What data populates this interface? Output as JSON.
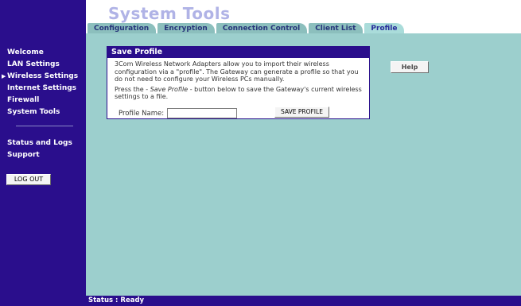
{
  "header": {
    "title": "System Tools"
  },
  "tabs": [
    {
      "label": "Configuration",
      "active": false
    },
    {
      "label": "Encryption",
      "active": false
    },
    {
      "label": "Connection Control",
      "active": false
    },
    {
      "label": "Client List",
      "active": false
    },
    {
      "label": "Profile",
      "active": true
    }
  ],
  "sidebar": {
    "items": [
      {
        "label": "Welcome"
      },
      {
        "label": "LAN Settings"
      },
      {
        "label": "Wireless Settings",
        "current": true
      },
      {
        "label": "Internet Settings"
      },
      {
        "label": "Firewall"
      },
      {
        "label": "System Tools"
      }
    ],
    "items2": [
      {
        "label": "Status and Logs"
      },
      {
        "label": "Support"
      }
    ],
    "logout_label": "LOG OUT",
    "current_arrow": "▶"
  },
  "panel": {
    "title": "Save Profile",
    "para1": "3Com Wireless Network Adapters allow you to import their wireless configuration via a \"profile\". The Gateway can generate a profile so that you do not need to configure your Wireless PCs manually.",
    "para2_prefix": "Press the - ",
    "para2_em": "Save Profile",
    "para2_suffix": " - button below to save the Gateway's current wireless settings to a file.",
    "profile_label": "Profile Name:",
    "profile_value": "",
    "save_label": "SAVE PROFILE"
  },
  "help_label": "Help",
  "status": {
    "text": "Status : Ready"
  },
  "colors": {
    "nav_bg": "#2a0e8c",
    "content_bg": "#9ccfcd",
    "tab_bg": "#8cbfbd",
    "tab_active_bg": "#aadcda",
    "title_color": "#b0b3e6"
  }
}
